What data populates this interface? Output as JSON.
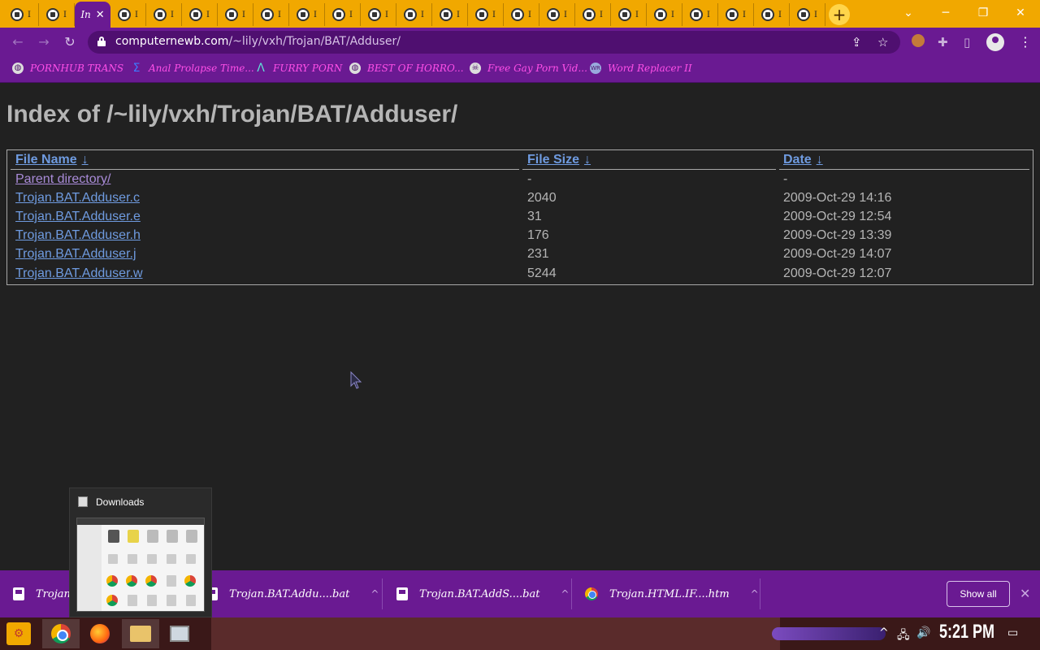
{
  "browser": {
    "active_tab": {
      "title": "In",
      "close": "✕"
    },
    "tab_glyph": "I",
    "new_tab_label": "+",
    "window_controls": {
      "dropdown": "⌄",
      "minimize": "─",
      "restore": "❐",
      "close": "✕"
    },
    "url_host": "computernewb.com",
    "url_path": "/~lily/vxh/Trojan/BAT/Adduser/",
    "bookmarks": [
      {
        "label": "PORNHUB TRANS",
        "icon": "globe-icon"
      },
      {
        "label": "Anal Prolapse Time...",
        "icon": "sigma-icon"
      },
      {
        "label": "FURRY PORN",
        "icon": "lambda-icon"
      },
      {
        "label": "BEST OF HORRO...",
        "icon": "globe-icon"
      },
      {
        "label": "Free Gay Porn Vid...",
        "icon": "skull-icon"
      },
      {
        "label": "Word Replacer II",
        "icon": "wr-icon"
      }
    ],
    "accent_color": "#6a1a92",
    "tab_strip_color": "#f1a800"
  },
  "page": {
    "title": "Index of /~lily/vxh/Trojan/BAT/Adduser/",
    "columns": [
      "File Name",
      "File Size",
      "Date"
    ],
    "sort_glyph": "↓",
    "rows": [
      {
        "name": "Parent directory/",
        "size": "-",
        "date": "-"
      },
      {
        "name": "Trojan.BAT.Adduser.c",
        "size": "2040",
        "date": "2009-Oct-29 14:16"
      },
      {
        "name": "Trojan.BAT.Adduser.e",
        "size": "31",
        "date": "2009-Oct-29 12:54"
      },
      {
        "name": "Trojan.BAT.Adduser.h",
        "size": "176",
        "date": "2009-Oct-29 13:39"
      },
      {
        "name": "Trojan.BAT.Adduser.j",
        "size": "231",
        "date": "2009-Oct-29 14:07"
      },
      {
        "name": "Trojan.BAT.Adduser.w",
        "size": "5244",
        "date": "2009-Oct-29 12:07"
      }
    ]
  },
  "downloads_preview": {
    "title": "Downloads"
  },
  "download_shelf": {
    "items": [
      {
        "name": "Trojan",
        "icon": "file-icon"
      },
      {
        "name": "Trojan.BAT.Addu....bat",
        "icon": "file-icon"
      },
      {
        "name": "Trojan.BAT.AddS....bat",
        "icon": "file-icon"
      },
      {
        "name": "Trojan.HTML.IF....htm",
        "icon": "chrome-icon"
      }
    ],
    "show_all_label": "Show all",
    "close_label": "✕",
    "chevron": "^"
  },
  "taskbar": {
    "clock": "5:21 PM",
    "apps": [
      "chrome",
      "firefox",
      "file-explorer",
      "screen-app"
    ]
  }
}
